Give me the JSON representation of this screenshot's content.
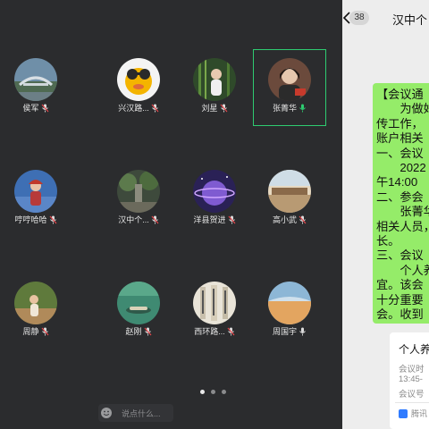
{
  "participants": [
    {
      "name": "侯军"
    },
    {
      "name": "兴汉路..."
    },
    {
      "name": "刘星"
    },
    {
      "name": "张菁华"
    },
    {
      "name": "哼哼哈哈"
    },
    {
      "name": "汉中个..."
    },
    {
      "name": "洋县贺进"
    },
    {
      "name": "高小武"
    },
    {
      "name": "周静"
    },
    {
      "name": "赵刚"
    },
    {
      "name": "西环路..."
    },
    {
      "name": "周国宇"
    }
  ],
  "pager": {
    "pages": 3,
    "current": 1
  },
  "chat_input": {
    "placeholder": "说点什么..."
  },
  "chat": {
    "back_icon": "chevron-left-icon",
    "unread": "38",
    "title": "汉中个",
    "message_lines": [
      "【会议通",
      "　　为做好",
      "传工作，",
      "账户相关",
      "一、会议",
      "　　2022",
      "午14:00",
      "二、参会",
      "　　张菁华",
      "相关人员，",
      "长。",
      "三、会议",
      "　　个人养",
      "宜。该会",
      "十分重要",
      "会。收到"
    ],
    "card": {
      "title": "个人养",
      "lines": [
        "会议时",
        "13:45-",
        "会议号"
      ],
      "source": "腾讯"
    }
  },
  "colors": {
    "call_bg": "#2b2c2e",
    "active_border": "#2ecc71",
    "bubble": "#95ec69",
    "chat_bg": "#ededed"
  }
}
